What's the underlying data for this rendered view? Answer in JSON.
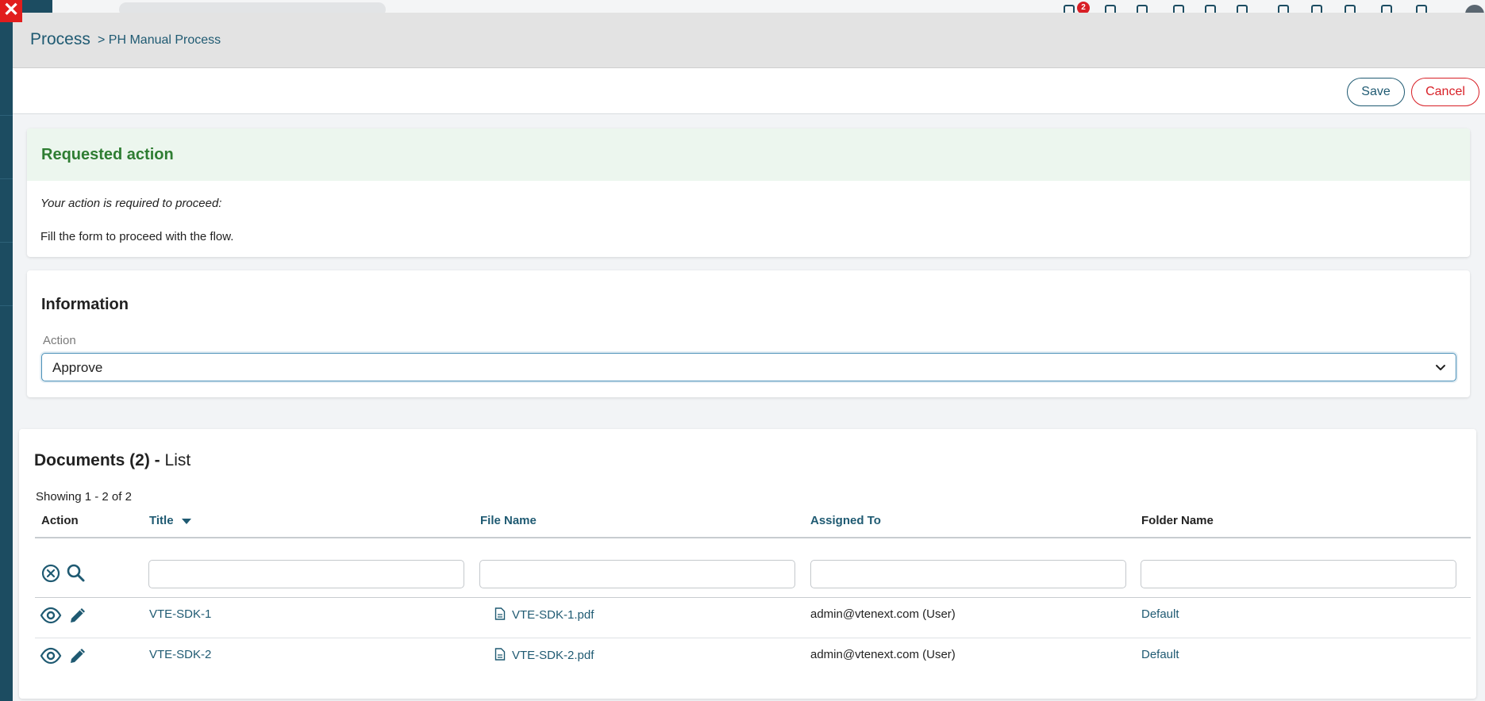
{
  "background": {
    "notification_count": "2"
  },
  "header": {
    "root": "Process",
    "sub": "> PH Manual Process"
  },
  "toolbar": {
    "save_label": "Save",
    "cancel_label": "Cancel"
  },
  "requested": {
    "title": "Requested action",
    "italic": "Your action is required to proceed:",
    "text": "Fill the form to proceed with the flow."
  },
  "information": {
    "title": "Information",
    "action_label": "Action",
    "action_value": "Approve"
  },
  "documents": {
    "title_bold": "Documents (2) -",
    "title_rest": " List",
    "showing": "Showing 1 - 2 of 2",
    "columns": [
      "Action",
      "Title",
      "File Name",
      "Assigned To",
      "Folder Name"
    ],
    "rows": [
      {
        "title": "VTE-SDK-1",
        "file": "VTE-SDK-1.pdf",
        "assigned": "admin@vtenext.com (User)",
        "folder": "Default"
      },
      {
        "title": "VTE-SDK-2",
        "file": "VTE-SDK-2.pdf",
        "assigned": "admin@vtenext.com (User)",
        "folder": "Default"
      }
    ]
  },
  "colors": {
    "primary": "#1f5a72",
    "danger": "#d81f26",
    "success": "#2e7d32"
  }
}
